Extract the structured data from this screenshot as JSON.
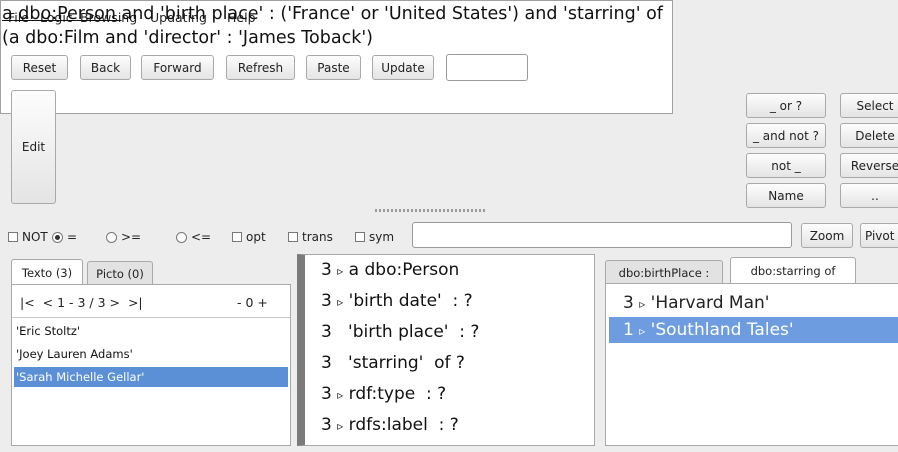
{
  "menu": [
    "File",
    "Logic",
    "Browsing",
    "Updating",
    "Help"
  ],
  "toolbar": {
    "reset": "Reset",
    "back": "Back",
    "forward": "Forward",
    "refresh": "Refresh",
    "paste": "Paste",
    "update": "Update",
    "input_value": ""
  },
  "editor": {
    "edit_label": "Edit",
    "query_part1": "a dbo:Person ",
    "query_part2": "and 'birth place'  : ('France' or 'United States') and 'starring'  of (a dbo:Film  and 'director'  : 'James Toback')"
  },
  "ops": {
    "or": "_ or ?",
    "and_not": "_ and not ?",
    "not": "not _",
    "name": "Name",
    "select": "Select",
    "delete": "Delete",
    "reverse": "Reverse",
    "dots": ".."
  },
  "options": {
    "not": "NOT",
    "eq": "=",
    "ge": ">=",
    "le": "<=",
    "opt": "opt",
    "trans": "trans",
    "sym": "sym",
    "zoom": "Zoom",
    "pivot": "Pivot",
    "selected_relation": "="
  },
  "left_tabs": {
    "texto": "Texto (3)",
    "picto": "Picto (0)"
  },
  "pager": {
    "nav": "|<  < 1 - 3 / 3 >  >|",
    "zoom": "- 0 +"
  },
  "entities": [
    "'Eric Stoltz'",
    "'Joey Lauren Adams'",
    "'Sarah Michelle Gellar'"
  ],
  "selected_entity": "'Sarah Michelle Gellar'",
  "properties": [
    {
      "count": "3",
      "arrow": "▹",
      "label": "a dbo:Person"
    },
    {
      "count": "3",
      "arrow": "▹",
      "label": "'birth date'  : ?"
    },
    {
      "count": "3",
      "arrow": "",
      "label": "'birth place'  : ?"
    },
    {
      "count": "3",
      "arrow": "",
      "label": "'starring'  of ?"
    },
    {
      "count": "3",
      "arrow": "▹",
      "label": "rdf:type  : ?"
    },
    {
      "count": "3",
      "arrow": "▹",
      "label": "rdfs:label  : ?"
    }
  ],
  "right_tabs": {
    "birthplace": "dbo:birthPlace :",
    "starring": "dbo:starring  of"
  },
  "values": [
    {
      "count": "3",
      "arrow": "▹",
      "label": "'Harvard Man'"
    },
    {
      "count": "1",
      "arrow": "▹",
      "label": "'Southland Tales'"
    }
  ],
  "colors": {
    "selection": "#5b8fd6",
    "panel_bg": "#ffffff",
    "window_bg": "#ededed"
  }
}
